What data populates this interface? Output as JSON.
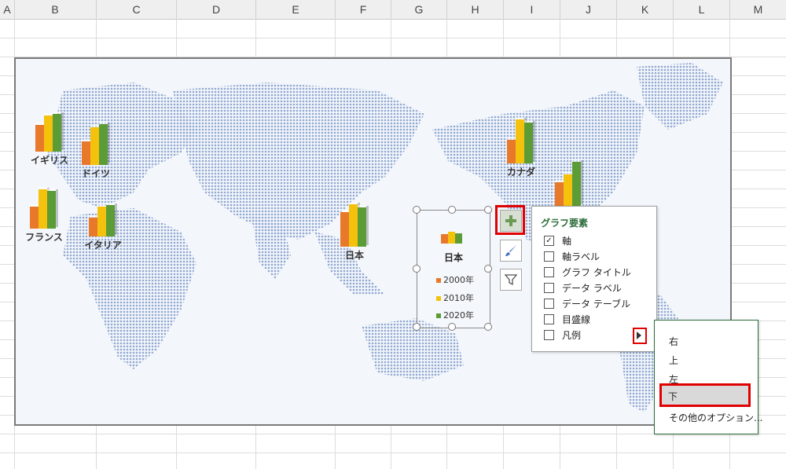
{
  "columns": [
    "A",
    "B",
    "C",
    "D",
    "E",
    "F",
    "G",
    "H",
    "I",
    "J",
    "K",
    "L",
    "M"
  ],
  "countries": [
    {
      "name": "イギリス"
    },
    {
      "name": "ドイツ"
    },
    {
      "name": "フランス"
    },
    {
      "name": "イタリア"
    },
    {
      "name": "日本"
    },
    {
      "name": "カナダ"
    }
  ],
  "selected_chart": {
    "title": "日本",
    "legend": [
      {
        "label": "2000年",
        "color": "#e8782a"
      },
      {
        "label": "2010年",
        "color": "#f4c20d"
      },
      {
        "label": "2020年",
        "color": "#5b9c36"
      }
    ]
  },
  "chart_buttons": {
    "elements_icon": "plus-icon",
    "styles_icon": "brush-icon",
    "filter_icon": "funnel-icon"
  },
  "elements_panel": {
    "title": "グラフ要素",
    "options": [
      {
        "label": "軸",
        "checked": true
      },
      {
        "label": "軸ラベル",
        "checked": false
      },
      {
        "label": "グラフ タイトル",
        "checked": false
      },
      {
        "label": "データ ラベル",
        "checked": false
      },
      {
        "label": "データ テーブル",
        "checked": false
      },
      {
        "label": "目盛線",
        "checked": false
      },
      {
        "label": "凡例",
        "checked": false
      }
    ]
  },
  "legend_submenu": {
    "items": [
      "右",
      "上",
      "左",
      "下",
      "その他のオプション..."
    ],
    "selected": "下"
  },
  "colors": {
    "accent_red": "#e00000",
    "panel_title": "#2c6e3b"
  }
}
